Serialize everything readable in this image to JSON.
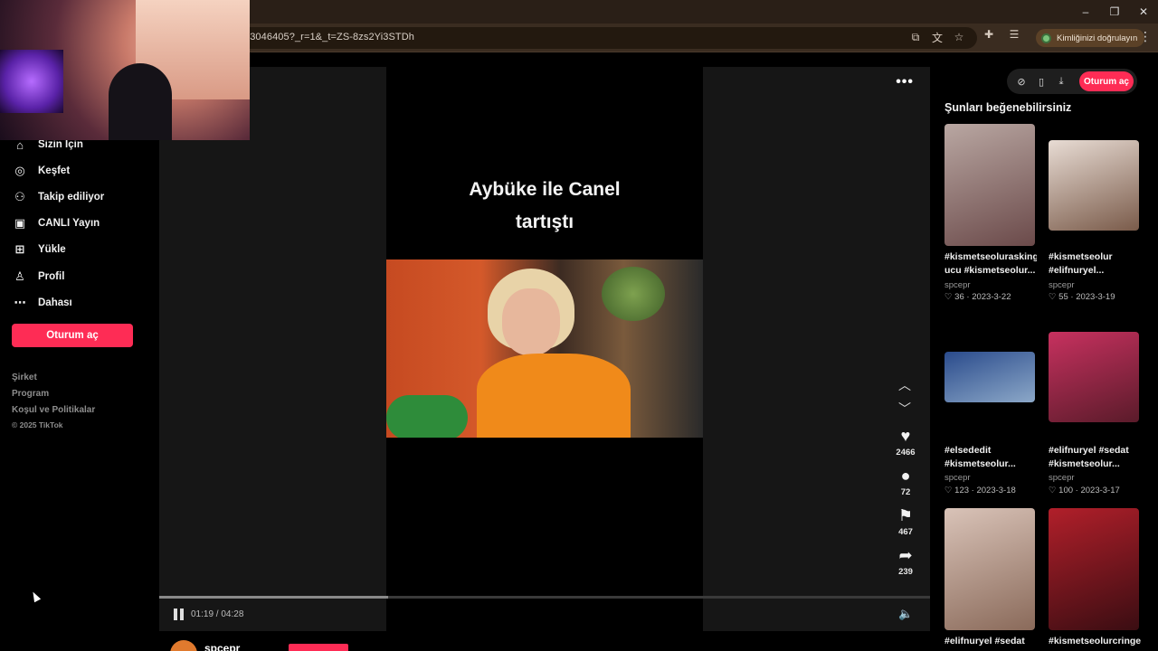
{
  "browser": {
    "url": "43046405?_r=1&_t=ZS-8zs2Yi3STDh",
    "verify_chip": "Kimliğinizi doğrulayın",
    "window_controls": [
      "–",
      "❐",
      "✕"
    ]
  },
  "sidebar": {
    "items": [
      {
        "label": "Sizin İçin",
        "icon": "home-icon",
        "glyph": "⌂"
      },
      {
        "label": "Keşfet",
        "icon": "compass-icon",
        "glyph": "◎"
      },
      {
        "label": "Takip ediliyor",
        "icon": "following-icon",
        "glyph": "⚇"
      },
      {
        "label": "CANLI Yayın",
        "icon": "live-tv-icon",
        "glyph": "▣"
      },
      {
        "label": "Yükle",
        "icon": "upload-icon",
        "glyph": "⊞"
      },
      {
        "label": "Profil",
        "icon": "profile-icon",
        "glyph": "♙"
      },
      {
        "label": "Dahası",
        "icon": "more-icon",
        "glyph": "⋯"
      }
    ],
    "signin_label": "Oturum aç",
    "footer_links": [
      "Şirket",
      "Program",
      "Koşul ve Politikalar"
    ],
    "copyright": "© 2025 TikTok"
  },
  "video": {
    "caption_line1": "Aybüke ile Canel",
    "caption_line2": "tartıştı",
    "actions": [
      {
        "name": "like",
        "icon": "heart-icon",
        "glyph": "♥",
        "count": "2466"
      },
      {
        "name": "comment",
        "icon": "comment-icon",
        "glyph": "●",
        "count": "72"
      },
      {
        "name": "bookmark",
        "icon": "bookmark-icon",
        "glyph": "⚑",
        "count": "467"
      },
      {
        "name": "share",
        "icon": "share-icon",
        "glyph": "➦",
        "count": "239"
      }
    ],
    "time": "01:19 / 04:28",
    "progress": 0.297,
    "author": "spcepr"
  },
  "right_panel": {
    "signin_label": "Oturum aç",
    "heading": "Şunları beğenebilirsiniz",
    "cards": [
      {
        "title1": "#kismetseolurasking",
        "title2": "ucu #kismetseolur...",
        "author": "spcepr",
        "likes": "36",
        "date": "2023-3-22",
        "colors": [
          "#b9a7a2",
          "#6b4a4a"
        ]
      },
      {
        "title1": "#kismetseolur",
        "title2": "#elifnuryel...",
        "author": "spcepr",
        "likes": "55",
        "date": "2023-3-19",
        "colors": [
          "#e8dcd4",
          "#7a5b4a"
        ]
      },
      {
        "title1": "#elsededit",
        "title2": "#kismetseolur...",
        "author": "spcepr",
        "likes": "123",
        "date": "2023-3-18",
        "colors": [
          "#2a4b8c",
          "#8ca8c8"
        ]
      },
      {
        "title1": "#elifnuryel #sedat",
        "title2": "#kismetseolur...",
        "author": "spcepr",
        "likes": "100",
        "date": "2023-3-17",
        "colors": [
          "#c7315f",
          "#5a1b2a"
        ]
      },
      {
        "title1": "#elifnuryel #sedat",
        "title2": "",
        "author": "",
        "likes": "",
        "date": "",
        "colors": [
          "#d9c3b8",
          "#8a6a5a"
        ]
      },
      {
        "title1": "#kismetseolurcringe",
        "title2": "",
        "author": "",
        "likes": "",
        "date": "",
        "colors": [
          "#b11f2a",
          "#3a0d12"
        ]
      }
    ]
  }
}
